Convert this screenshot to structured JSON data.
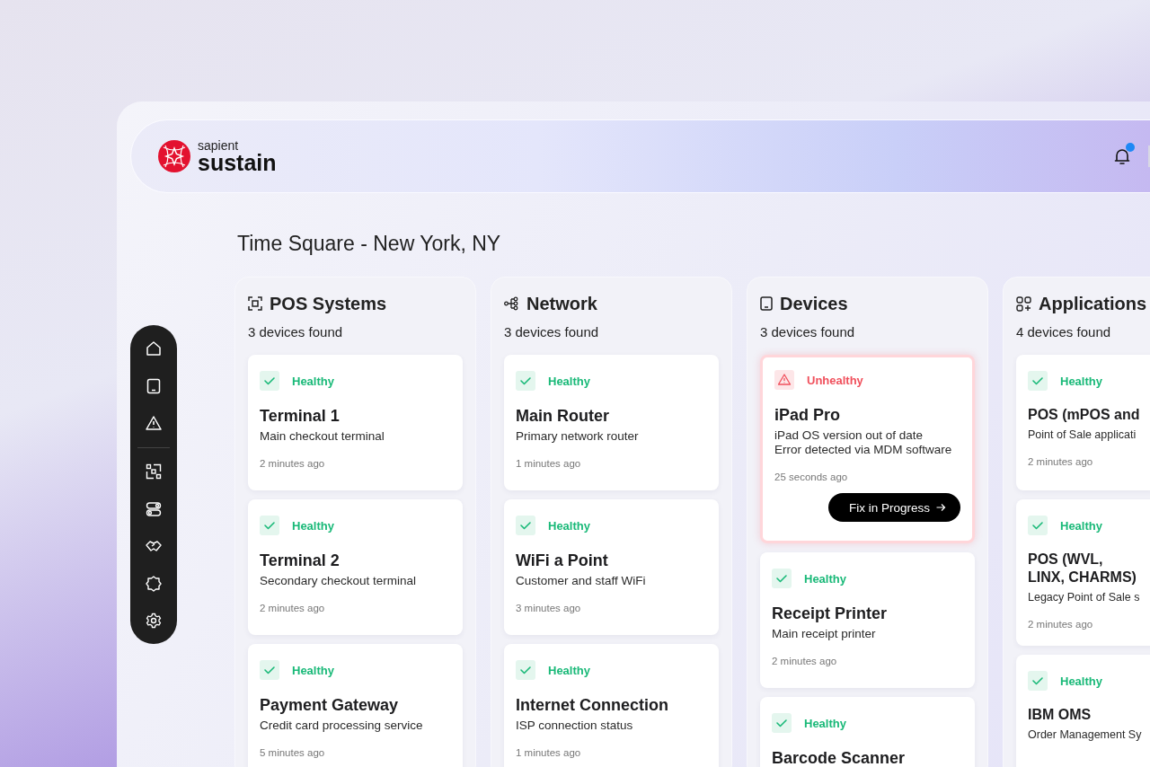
{
  "brand": {
    "line_1": "sapient",
    "line_2": "sustain"
  },
  "notifications": {
    "unread": true
  },
  "page_title": "Time Square - New York, NY",
  "columns": [
    {
      "kind": "pos",
      "title": "POS Systems",
      "count": "3 devices found",
      "cards": [
        {
          "kind": "healthy",
          "status_label": "Healthy",
          "title": "Terminal 1",
          "lines": [
            "Main checkout terminal"
          ],
          "time": "2 minutes ago"
        },
        {
          "kind": "healthy",
          "status_label": "Healthy",
          "title": "Terminal 2",
          "lines": [
            "Secondary checkout terminal"
          ],
          "time": "2 minutes ago"
        },
        {
          "kind": "healthy",
          "status_label": "Healthy",
          "title": "Payment Gateway",
          "lines": [
            "Credit card processing service"
          ],
          "time": "5 minutes ago"
        }
      ]
    },
    {
      "kind": "network",
      "title": "Network",
      "count": "3 devices found",
      "cards": [
        {
          "kind": "healthy",
          "status_label": "Healthy",
          "title": "Main Router",
          "lines": [
            "Primary network router"
          ],
          "time": "1 minutes ago"
        },
        {
          "kind": "healthy",
          "status_label": "Healthy",
          "title": "WiFi a Point",
          "lines": [
            "Customer and staff WiFi"
          ],
          "time": "3 minutes ago"
        },
        {
          "kind": "healthy",
          "status_label": "Healthy",
          "title": "Internet Connection",
          "lines": [
            "ISP connection status"
          ],
          "time": "1 minutes ago"
        }
      ]
    },
    {
      "kind": "devices",
      "title": "Devices",
      "count": "3 devices found",
      "cards": [
        {
          "kind": "unhealthy",
          "status_label": "Unhealthy",
          "title": "iPad Pro",
          "lines": [
            "iPad OS version out of date",
            "Error detected via MDM software"
          ],
          "time": "25 seconds ago",
          "action": "Fix in Progress"
        },
        {
          "kind": "healthy",
          "status_label": "Healthy",
          "title": "Receipt Printer",
          "lines": [
            "Main receipt printer"
          ],
          "time": "2 minutes ago"
        },
        {
          "kind": "healthy",
          "status_label": "Healthy",
          "title": "Barcode Scanner"
        }
      ]
    },
    {
      "kind": "applications",
      "title": "Applications",
      "count": "4 devices found",
      "cards": [
        {
          "kind": "healthy",
          "status_label": "Healthy",
          "title": "POS (mPOS and",
          "lines": [
            "Point of Sale applicati"
          ],
          "time": "2 minutes ago"
        },
        {
          "kind": "healthy",
          "status_label": "Healthy",
          "title": "POS (WVL, LINX, CHARMS)",
          "lines": [
            "Legacy Point of Sale s"
          ],
          "time": "2 minutes ago"
        },
        {
          "kind": "healthy",
          "status_label": "Healthy",
          "title": "IBM OMS",
          "lines": [
            "Order Management Sy"
          ]
        }
      ]
    }
  ]
}
